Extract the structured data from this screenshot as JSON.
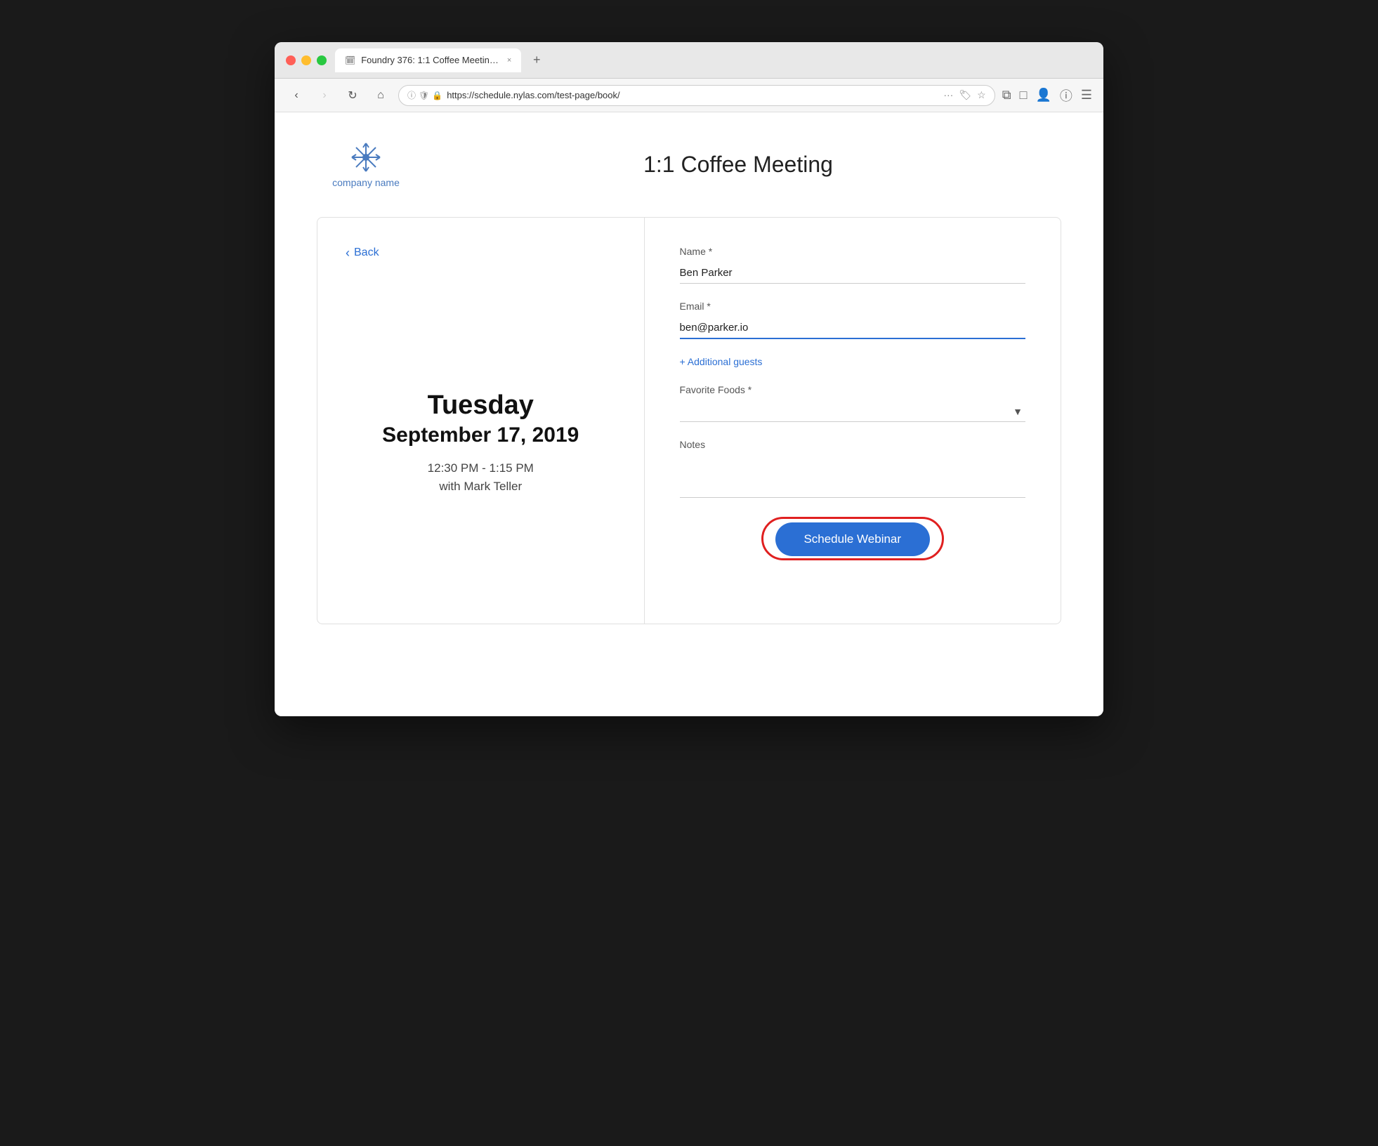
{
  "browser": {
    "tab_title": "Foundry 376: 1:1 Coffee Meetin…",
    "tab_close": "×",
    "tab_new": "+",
    "address": "https://schedule.nylas.com/test-page/book/",
    "back_btn": "‹",
    "forward_btn": "›",
    "refresh_btn": "↻",
    "home_btn": "⌂"
  },
  "page": {
    "title": "1:1 Coffee Meeting",
    "company_name": "company\nname"
  },
  "left_panel": {
    "back_label": "Back",
    "day": "Tuesday",
    "date": "September 17, 2019",
    "time": "12:30 PM - 1:15 PM",
    "with": "with Mark Teller"
  },
  "form": {
    "name_label": "Name *",
    "name_value": "Ben Parker",
    "email_label": "Email *",
    "email_value": "ben@parker.io",
    "add_guests_label": "+ Additional guests",
    "favorite_foods_label": "Favorite Foods *",
    "notes_label": "Notes",
    "schedule_btn": "Schedule Webinar"
  }
}
